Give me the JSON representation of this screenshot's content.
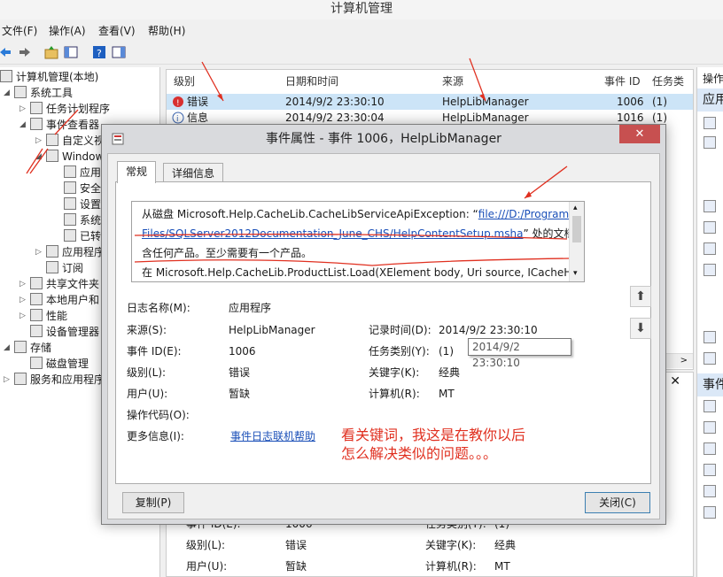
{
  "window": {
    "title": "计算机管理"
  },
  "menu": {
    "file": "文件(F)",
    "action": "操作(A)",
    "view": "查看(V)",
    "help": "帮助(H)"
  },
  "tree": {
    "root": "计算机管理(本地)",
    "system_tools": "系统工具",
    "task_scheduler": "任务计划程序",
    "event_viewer": "事件查看器",
    "custom_views": "自定义视",
    "windows_logs": "Window",
    "app": "应用",
    "security": "安全",
    "setup": "设置",
    "system": "系统",
    "forwarded": "已转",
    "app_services": "应用程序",
    "subscriptions": "订阅",
    "shared_folders": "共享文件夹",
    "local_users": "本地用户和",
    "performance": "性能",
    "device_manager": "设备管理器",
    "storage": "存储",
    "disk_management": "磁盘管理",
    "services_apps": "服务和应用程序"
  },
  "grid": {
    "columns": [
      "级别",
      "日期和时间",
      "来源",
      "事件 ID",
      "任务类别"
    ],
    "rows": [
      {
        "level": "错误",
        "datetime": "2014/9/2 23:30:10",
        "source": "HelpLibManager",
        "event_id": "1006",
        "category": "(1)"
      },
      {
        "level": "信息",
        "datetime": "2014/9/2 23:30:04",
        "source": "HelpLibManager",
        "event_id": "1016",
        "category": "(1)"
      }
    ]
  },
  "lower_panel": {
    "event_id_label": "事件 ID(E):",
    "event_id_value": "1006",
    "category_label": "任务类别(Y):",
    "category_value": "(1)",
    "level_label": "级别(L):",
    "level_value": "错误",
    "keywords_label": "关键字(K):",
    "keywords_value": "经典",
    "user_label": "用户(U):",
    "user_value": "暂缺",
    "computer_label": "计算机(R):",
    "computer_value": "MT"
  },
  "actions_pane": {
    "header": "操作",
    "section1": "应用",
    "section2": "事件"
  },
  "dialog": {
    "title": "事件属性 - 事件 1006，HelpLibManager",
    "close": "✕",
    "tabs": [
      "常规",
      "详细信息"
    ],
    "description": {
      "line1_prefix": "从磁盘 Microsoft.Help.CacheLib.CacheLibServiceApiException:  “",
      "line1_link": "file:///D:/Program",
      "line2_link": "Files/SQLServer2012Documentation_June_CHS/HelpContentSetup.msha",
      "line2_suffix": "” 处的文档不包",
      "line3": "含任何产品。至少需要有一个产品。",
      "line4": "   在 Microsoft.Help.CacheLib.ProductList.Load(XElement body, Uri source, ICacheHost"
    },
    "fields": {
      "log_name_label": "日志名称(M):",
      "log_name_value": "应用程序",
      "source_label": "来源(S):",
      "source_value": "HelpLibManager",
      "logged_label": "记录时间(D):",
      "logged_value": "2014/9/2 23:30:10",
      "event_id_label": "事件 ID(E):",
      "event_id_value": "1006",
      "category_label": "任务类别(Y):",
      "category_value": "(1)",
      "level_label": "级别(L):",
      "level_value": "错误",
      "keywords_label": "关键字(K):",
      "keywords_value": "经典",
      "user_label": "用户(U):",
      "user_value": "暂缺",
      "computer_label": "计算机(R):",
      "computer_value": "MT",
      "opcode_label": "操作代码(O):",
      "more_info_label": "更多信息(I):",
      "more_info_link": "事件日志联机帮助"
    },
    "tooltip": "2014/9/2 23:30:10",
    "annotation_line1": "看关键词，我这是在教你以后",
    "annotation_line2": "怎么解决类似的问题。。。",
    "copy_button": "复制(P)",
    "close_button": "关闭(C)"
  },
  "colors": {
    "annotation": "#e03020",
    "link": "#1a4fb8",
    "close_bg": "#c75050"
  }
}
